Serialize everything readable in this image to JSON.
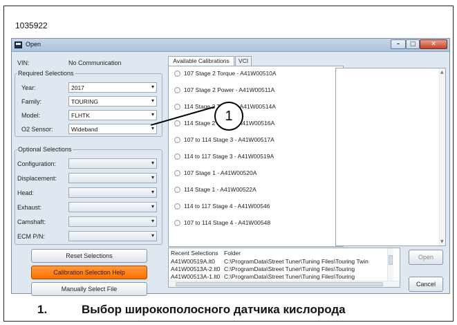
{
  "figure_id": "1035922",
  "window": {
    "title": "Open",
    "minimize": "–",
    "maximize": "□",
    "close": "✕"
  },
  "vin": {
    "label": "VIN:",
    "value": "No Communication"
  },
  "required": {
    "title": "Required Selections",
    "fields": [
      {
        "label": "Year:",
        "value": "2017"
      },
      {
        "label": "Family:",
        "value": "TOURING"
      },
      {
        "label": "Model:",
        "value": "FLHTK"
      },
      {
        "label": "O2 Sensor:",
        "value": "Wideband"
      }
    ]
  },
  "optional": {
    "title": "Optional Selections",
    "fields": [
      {
        "label": "Configuration:",
        "value": ""
      },
      {
        "label": "Displacement:",
        "value": ""
      },
      {
        "label": "Head:",
        "value": ""
      },
      {
        "label": "Exhaust:",
        "value": ""
      },
      {
        "label": "Camshaft:",
        "value": ""
      },
      {
        "label": "ECM P/N:",
        "value": ""
      }
    ]
  },
  "buttons": {
    "reset": "Reset Selections",
    "help": "Calibration Selection Help",
    "manual": "Manually Select File",
    "open": "Open",
    "cancel": "Cancel"
  },
  "tabs": [
    "Available Calibrations",
    "VCI"
  ],
  "calibrations": [
    "107 Stage 2 Torque - A41W00510A",
    "107 Stage 2 Power - A41W00511A",
    "114 Stage 2 Torque - A41W00514A",
    "114 Stage 2 Power - A41W00516A",
    "107 to 114 Stage 3 - A41W00517A",
    "114 to 117 Stage 3 - A41W00519A",
    "107 Stage 1 - A41W00520A",
    "114 Stage 1 - A41W00522A",
    "114 to 117 Stage 4 - A41W00546",
    "107 to 114 Stage 4 - A41W00548"
  ],
  "recent": {
    "headers": [
      "Recent Selections",
      "Folder"
    ],
    "rows": [
      {
        "file": "A41W00519A.lt0",
        "folder": "C:\\ProgramData\\Street Tuner\\Tuning Files\\Touring Twin"
      },
      {
        "file": "A41W00513A-2.lt0",
        "folder": "C:\\ProgramData\\Street Tuner\\Tuning Files\\Touring"
      },
      {
        "file": "A41W00513A-1.lt0",
        "folder": "C:\\ProgramData\\Street Tuner\\Tuning Files\\Touring"
      }
    ]
  },
  "callout": {
    "number": "1"
  },
  "caption": {
    "number": "1.",
    "text": "Выбор широкополосного датчика кислорода"
  }
}
